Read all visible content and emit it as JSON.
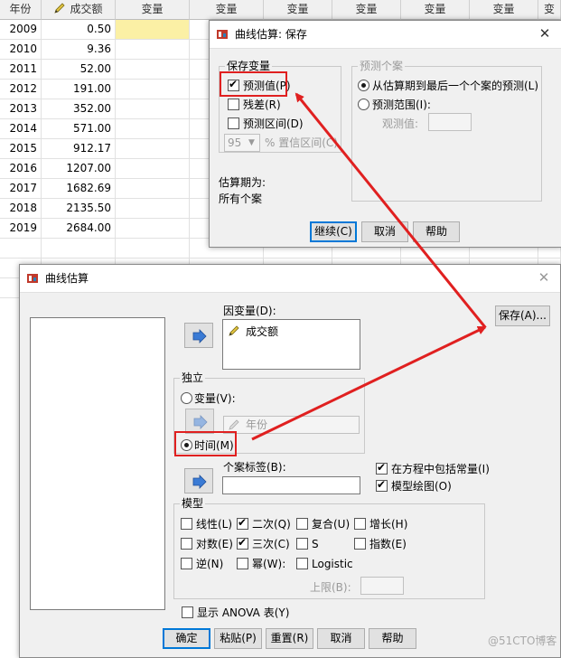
{
  "sheet": {
    "headers": [
      "年份",
      "成交额",
      "变量",
      "变量",
      "变量",
      "变量",
      "变量",
      "变量",
      "变"
    ],
    "rows": [
      {
        "year": "2009",
        "amount": "0.50"
      },
      {
        "year": "2010",
        "amount": "9.36"
      },
      {
        "year": "2011",
        "amount": "52.00"
      },
      {
        "year": "2012",
        "amount": "191.00"
      },
      {
        "year": "2013",
        "amount": "352.00"
      },
      {
        "year": "2014",
        "amount": "571.00"
      },
      {
        "year": "2015",
        "amount": "912.17"
      },
      {
        "year": "2016",
        "amount": "1207.00"
      },
      {
        "year": "2017",
        "amount": "1682.69"
      },
      {
        "year": "2018",
        "amount": "2135.50"
      },
      {
        "year": "2019",
        "amount": "2684.00"
      }
    ]
  },
  "save_dialog": {
    "title": "曲线估算: 保存",
    "save_vars": {
      "legend": "保存变量",
      "predicted": "预测值(P)",
      "predicted_checked": true,
      "residual": "残差(R)",
      "residual_checked": false,
      "interval": "预测区间(D)",
      "interval_checked": false,
      "conf_value": "95",
      "conf_label": "% 置信区间(C)"
    },
    "predict_cases": {
      "legend": "预测个案",
      "opt_last": "从估算期到最后一个个案的预测(L)",
      "opt_range": "预测范围(I):",
      "obs_label": "观测值:"
    },
    "period_label": "估算期为:",
    "period_value": "所有个案",
    "buttons": {
      "continue": "继续(C)",
      "cancel": "取消",
      "help": "帮助"
    }
  },
  "main_dialog": {
    "title": "曲线估算",
    "dependent_label": "因变量(D):",
    "dependent_item": "成交额",
    "save_button": "保存(A)...",
    "independent": {
      "legend": "独立",
      "variable_opt": "变量(V):",
      "variable_value": "年份",
      "time_opt": "时间(M)"
    },
    "case_label": "个案标签(B):",
    "include_constant": "在方程中包括常量(I)",
    "include_constant_checked": true,
    "plot_models": "模型绘图(O)",
    "plot_models_checked": true,
    "models": {
      "legend": "模型",
      "items": [
        {
          "label": "线性(L)",
          "checked": false
        },
        {
          "label": "二次(Q)",
          "checked": true
        },
        {
          "label": "复合(U)",
          "checked": false
        },
        {
          "label": "增长(H)",
          "checked": false
        },
        {
          "label": "对数(E)",
          "checked": false
        },
        {
          "label": "三次(C)",
          "checked": true
        },
        {
          "label": "S",
          "checked": false
        },
        {
          "label": "指数(E)",
          "checked": false
        },
        {
          "label": "逆(N)",
          "checked": false
        },
        {
          "label": "幂(W):",
          "checked": false
        },
        {
          "label": "Logistic",
          "checked": false
        }
      ],
      "upper_label": "上限(B):"
    },
    "show_anova": "显示 ANOVA 表(Y)",
    "buttons": {
      "ok": "确定",
      "paste": "粘贴(P)",
      "reset": "重置(R)",
      "cancel": "取消",
      "help": "帮助"
    }
  },
  "watermark": "@51CTO博客",
  "colors": {
    "annotation": "#e02020",
    "selected_cell": "#fbf0a5",
    "default_button": "#0078d7"
  }
}
